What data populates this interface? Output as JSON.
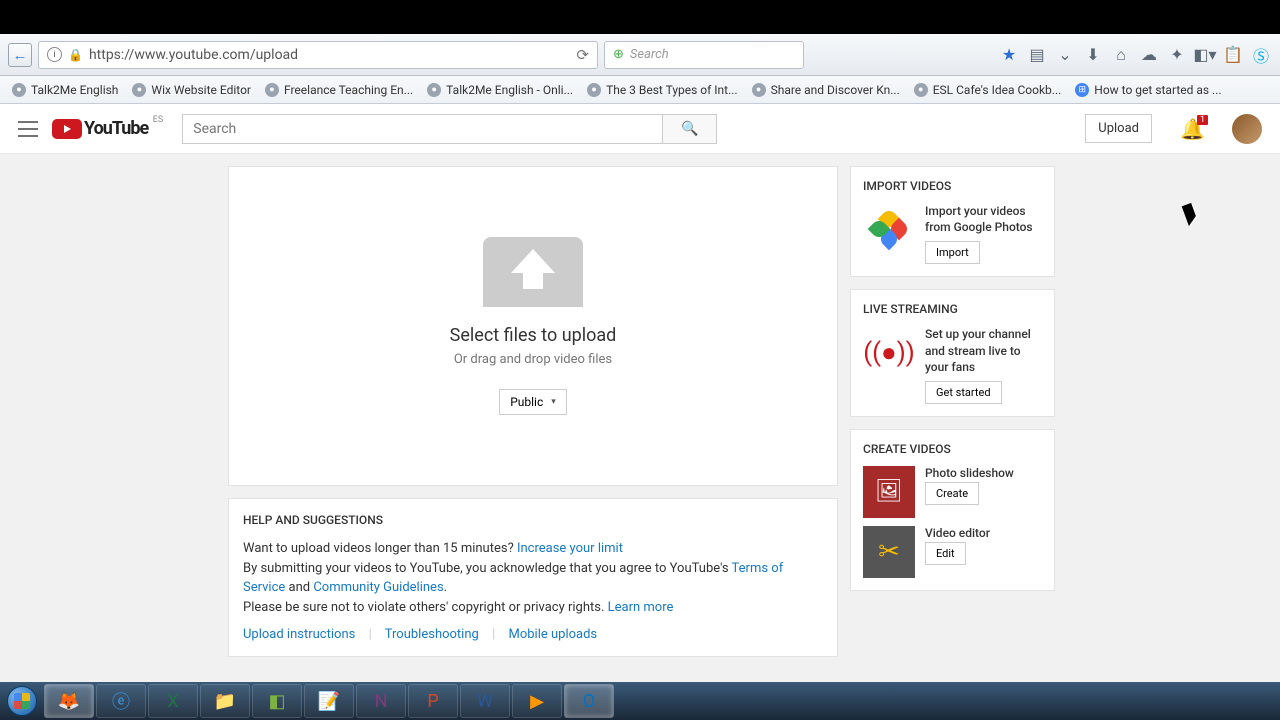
{
  "browser": {
    "url": "https://www.youtube.com/upload",
    "search_placeholder": "Search",
    "bookmarks": [
      "Talk2Me English",
      "Wix Website Editor",
      "Freelance Teaching En...",
      "Talk2Me English - Onli...",
      "The 3 Best Types of Int...",
      "Share and Discover Kn...",
      "ESL Cafe's Idea Cookb...",
      "How to get started as ..."
    ]
  },
  "masthead": {
    "logo_text": "YouTube",
    "country_code": "ES",
    "search_placeholder": "Search",
    "upload_label": "Upload",
    "notification_count": "1"
  },
  "upload": {
    "title": "Select files to upload",
    "subtitle": "Or drag and drop video files",
    "privacy": "Public"
  },
  "help": {
    "heading": "HELP AND SUGGESTIONS",
    "line1_pre": "Want to upload videos longer than 15 minutes? ",
    "line1_link": "Increase your limit",
    "line2_pre": "By submitting your videos to YouTube, you acknowledge that you agree to YouTube's ",
    "line2_tos": "Terms of Service",
    "line2_and": " and ",
    "line2_cg": "Community Guidelines",
    "line2_dot": ".",
    "line3_pre": "Please be sure not to violate others' copyright or privacy rights. ",
    "line3_link": "Learn more",
    "links": [
      "Upload instructions",
      "Troubleshooting",
      "Mobile uploads"
    ]
  },
  "sidebar": {
    "import": {
      "heading": "IMPORT VIDEOS",
      "desc": "Import your videos from Google Photos",
      "button": "Import"
    },
    "live": {
      "heading": "LIVE STREAMING",
      "desc": "Set up your channel and stream live to your fans",
      "button": "Get started"
    },
    "create": {
      "heading": "CREATE VIDEOS",
      "slideshow_title": "Photo slideshow",
      "slideshow_button": "Create",
      "editor_title": "Video editor",
      "editor_button": "Edit"
    }
  }
}
